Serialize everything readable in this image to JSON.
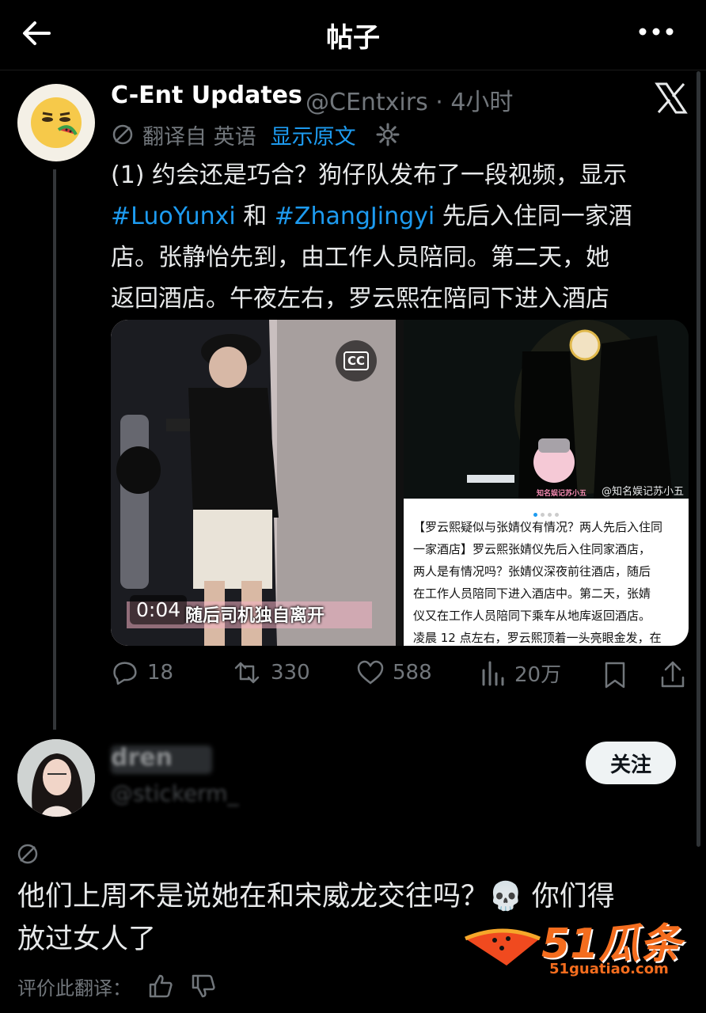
{
  "header": {
    "title": "帖子",
    "back_icon": "back-arrow-icon",
    "more_icon": "more-icon"
  },
  "post": {
    "author_name": "C-Ent Updates",
    "handle_and_time": "@CEntxirs · 4小时",
    "translation_label": "翻译自 英语",
    "show_original": "显示原文",
    "body_lines": [
      {
        "prefix": "(1) 约会还是巧合？狗仔队发布了一段视频，显示",
        "tag1": "",
        "mid": "",
        "tag2": "",
        "suffix": ""
      },
      {
        "prefix": "",
        "tag1": "#LuoYunxi",
        "mid": " 和 ",
        "tag2": "#ZhangJingyi",
        "suffix": " 先后入住同一家酒"
      },
      {
        "prefix": "店。张静怡先到，由工作人员陪同。第二天，她",
        "tag1": "",
        "mid": "",
        "tag2": "",
        "suffix": ""
      },
      {
        "prefix": "返回酒店。午夜左右，罗云熙在陪同下进入酒店",
        "tag1": "",
        "mid": "",
        "tag2": "",
        "suffix": ""
      }
    ],
    "media": {
      "video_timestamp": "0:04",
      "subtitle": "随后司机独自离开",
      "cc_label": "CC",
      "watermark_right": "@知名娱记苏小五",
      "cartoon_caption": "知名娱记苏小五",
      "article_lines": [
        "【罗云熙疑似与张婧仪有情况？两人先后入住同",
        "一家酒店】罗云熙张婧仪先后入住同家酒店，",
        "两人是有情况吗？张婧仪深夜前往酒店，随后",
        "在工作人员陪同下进入酒店中。第二天，张婧",
        "仪又在工作人员陪同下乘车从地库返回酒店。",
        "凌晨 12 点左右，罗云熙顶着一头亮眼金发，在"
      ]
    },
    "actions": {
      "replies": "18",
      "reposts": "330",
      "likes": "588",
      "views": "20万"
    }
  },
  "reply": {
    "name": "dren",
    "handle": "@stickerm_",
    "follow_label": "关注",
    "text_lines": [
      "他们上周不是说她在和宋威龙交往吗？💀 你们得",
      "放过女人了"
    ],
    "rate_label": "评价此翻译："
  },
  "watermark": {
    "big": "51瓜条",
    "url": "51guatiao.com"
  },
  "colors": {
    "accent": "#1d9bf0",
    "muted": "#71767b",
    "bg": "#000000"
  }
}
